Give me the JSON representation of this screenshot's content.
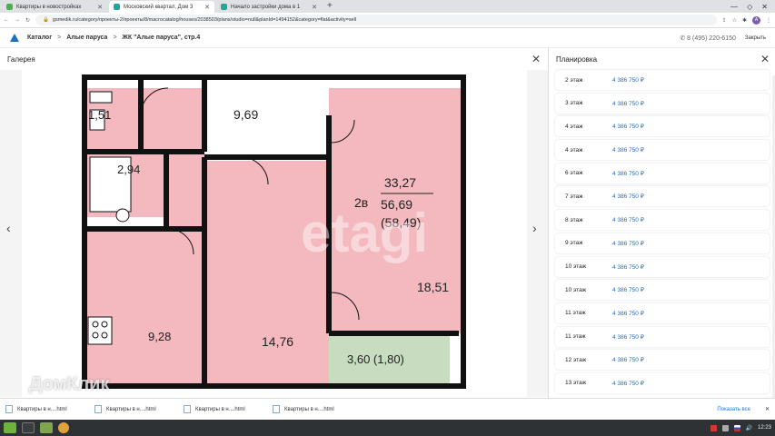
{
  "browser": {
    "tabs": [
      {
        "title": "Квартиры в новостройках",
        "color": "#4caf50"
      },
      {
        "title": "Московский квартал, Дом 3",
        "color": "#26a69a"
      },
      {
        "title": "Начало застройки дома в 1",
        "color": "#26a69a"
      }
    ],
    "url": "gsmedik.ru/category/проекты-2/проекты/8/macrocatalog/houses/2038503/plans/studio=null&planId=1494152&category=flat&activity=sell"
  },
  "site": {
    "breadcrumbs": [
      "Каталог",
      ">",
      "Алые паруса",
      ">",
      "ЖК \"Алые паруса\", стр.4"
    ],
    "phone": "8 (495) 220-6150",
    "close_label": "Закрыть"
  },
  "gallery": {
    "title": "Галерея",
    "plan": {
      "rooms": [
        "1,51",
        "9,69",
        "2,94",
        "9,28",
        "14,76",
        "18,51",
        "3,60 (1,80)"
      ],
      "type": "2в",
      "living": "33,27",
      "total": "56,69",
      "total_with_balcony": "(58,49)",
      "watermark": "etagi"
    }
  },
  "planning": {
    "title": "Планировка",
    "rows": [
      {
        "floor": "2 этаж",
        "price": "4 386 750 ₽"
      },
      {
        "floor": "3 этаж",
        "price": "4 386 750 ₽"
      },
      {
        "floor": "4 этаж",
        "price": "4 386 750 ₽"
      },
      {
        "floor": "4 этаж",
        "price": "4 386 750 ₽"
      },
      {
        "floor": "6 этаж",
        "price": "4 386 750 ₽"
      },
      {
        "floor": "7 этаж",
        "price": "4 386 750 ₽"
      },
      {
        "floor": "8 этаж",
        "price": "4 386 750 ₽"
      },
      {
        "floor": "9 этаж",
        "price": "4 386 750 ₽"
      },
      {
        "floor": "10 этаж",
        "price": "4 386 750 ₽"
      },
      {
        "floor": "10 этаж",
        "price": "4 386 750 ₽"
      },
      {
        "floor": "11 этаж",
        "price": "4 386 750 ₽"
      },
      {
        "floor": "11 этаж",
        "price": "4 386 750 ₽"
      },
      {
        "floor": "12 этаж",
        "price": "4 386 750 ₽"
      },
      {
        "floor": "13 этаж",
        "price": "4 386 750 ₽"
      }
    ]
  },
  "downloads": {
    "items": [
      "Квартиры в н....html",
      "Квартиры в н....html",
      "Квартиры в н....html",
      "Квартиры в н....html"
    ],
    "show_all": "Показать все"
  },
  "taskbar": {
    "time": "12:23"
  },
  "watermark_site": "ДомКлик"
}
